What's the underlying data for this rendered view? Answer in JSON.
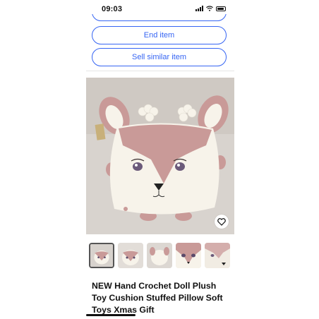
{
  "status_bar": {
    "time": "09:03"
  },
  "actions": {
    "end_item": "End item",
    "sell_similar": "Sell similar item"
  },
  "listing": {
    "title": "NEW  Hand Crochet Doll Plush Toy Cushion Stuffed Pillow Soft Toys Xmas Gift"
  },
  "gallery": {
    "thumbnail_count": 5,
    "selected_index": 0
  },
  "colors": {
    "accent": "#3665f3",
    "pink": "#c99a98",
    "cream": "#f7f3ea"
  },
  "icons": [
    "cellular-signal-icon",
    "wifi-icon",
    "battery-icon",
    "heart-icon"
  ]
}
